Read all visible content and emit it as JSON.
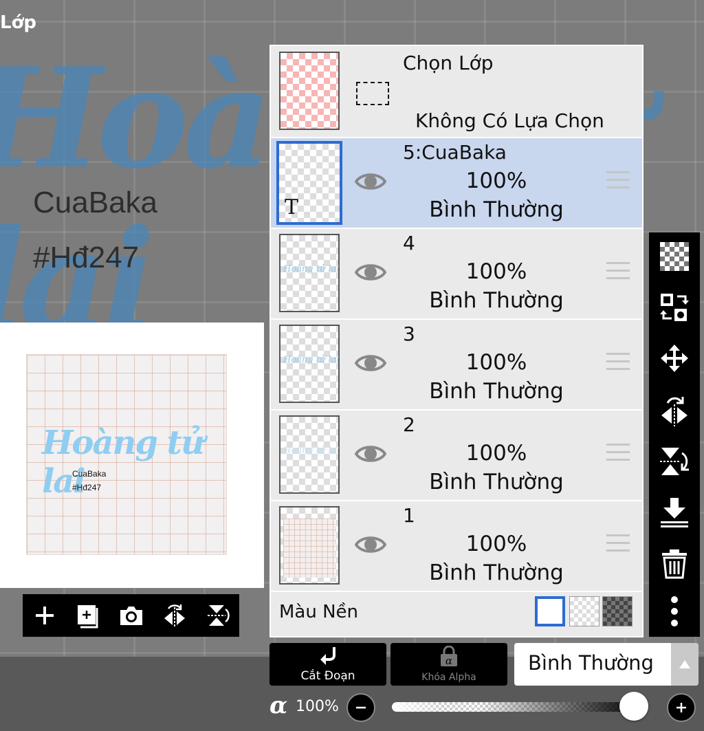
{
  "panel_title": "Lớp",
  "canvas": {
    "script_text": "Hoàng tử lai",
    "author": "CuaBaka",
    "tag": "#Hđ247"
  },
  "selection": {
    "title": "Chọn Lớp",
    "status": "Không Có Lựa Chọn"
  },
  "layers": [
    {
      "name": "5:CuaBaka",
      "opacity": "100%",
      "blend": "Bình Thường",
      "selected": true,
      "type": "text"
    },
    {
      "name": "4",
      "opacity": "100%",
      "blend": "Bình Thường",
      "selected": false,
      "type": "image"
    },
    {
      "name": "3",
      "opacity": "100%",
      "blend": "Bình Thường",
      "selected": false,
      "type": "image"
    },
    {
      "name": "2",
      "opacity": "100%",
      "blend": "Bình Thường",
      "selected": false,
      "type": "image"
    },
    {
      "name": "1",
      "opacity": "100%",
      "blend": "Bình Thường",
      "selected": false,
      "type": "grid"
    }
  ],
  "background_color": {
    "label": "Màu Nền",
    "options": [
      "white",
      "transparent",
      "dark"
    ],
    "selected": "white"
  },
  "preview_toolbar": [
    "add-layer-icon",
    "duplicate-layer-icon",
    "camera-icon",
    "flip-horizontal-icon",
    "flip-vertical-icon"
  ],
  "side_tools": [
    "transparency-icon",
    "swap-layer-icon",
    "move-icon",
    "flip-horizontal-icon",
    "flip-vertical-icon",
    "merge-down-icon",
    "trash-icon",
    "more-icon"
  ],
  "bottom": {
    "clip_label": "Cắt Đoạn",
    "alpha_lock_label": "Khóa Alpha",
    "blend_mode": "Bình Thường",
    "alpha_symbol": "α",
    "opacity_value": "100%",
    "opacity_fraction": 1.0
  },
  "colors": {
    "accent": "#2d6bd0",
    "selected_row": "#c8d6ee",
    "script_blue": "#8fcdf2"
  }
}
